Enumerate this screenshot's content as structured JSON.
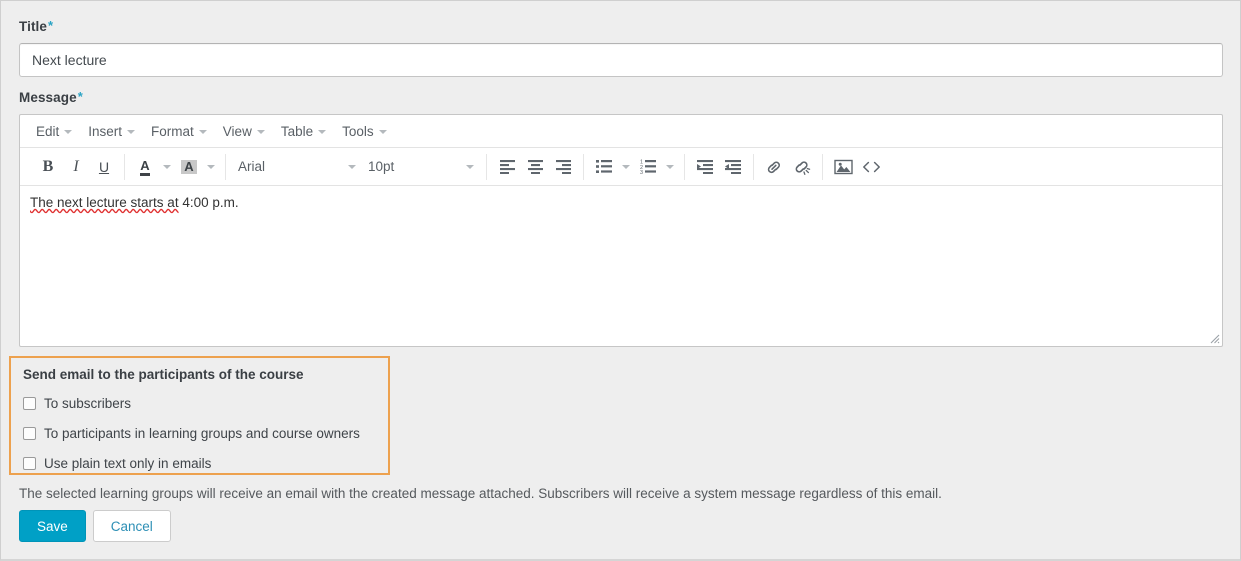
{
  "form": {
    "title_label": "Title",
    "required_marker": "*",
    "title_value": "Next lecture",
    "title_placeholder": "",
    "message_label": "Message"
  },
  "editor": {
    "menus": [
      {
        "label": "Edit",
        "icon": "chevron-down-icon"
      },
      {
        "label": "Insert",
        "icon": "chevron-down-icon"
      },
      {
        "label": "Format",
        "icon": "chevron-down-icon"
      },
      {
        "label": "View",
        "icon": "chevron-down-icon"
      },
      {
        "label": "Table",
        "icon": "chevron-down-icon"
      },
      {
        "label": "Tools",
        "icon": "chevron-down-icon"
      }
    ],
    "toolbar": {
      "bold": "B",
      "italic": "I",
      "underline": "U",
      "text_color_glyph": "A",
      "background_color_glyph": "A",
      "font_family": "Arial",
      "font_size": "10pt",
      "icons": [
        "align-left-icon",
        "align-center-icon",
        "align-right-icon",
        "bullet-list-icon",
        "numbered-list-icon",
        "indent-icon",
        "outdent-icon",
        "link-icon",
        "unlink-icon",
        "image-icon",
        "source-code-icon"
      ]
    },
    "content_misspelled": "The next lecture starts at",
    "content_rest": " 4:00 p.m."
  },
  "email_options": {
    "heading": "Send email to the participants of the course",
    "border_color": "#eda14e",
    "checkboxes": [
      {
        "label": "To subscribers",
        "checked": false
      },
      {
        "label": "To participants in learning groups and course owners",
        "checked": false
      },
      {
        "label": "Use plain text only in emails",
        "checked": false
      }
    ]
  },
  "footer": {
    "help_text": "The selected learning groups will receive an email with the created message attached. Subscribers will receive a system message regardless of this email.",
    "save_label": "Save",
    "cancel_label": "Cancel",
    "save_color": "#00a0c6",
    "cancel_text_color": "#2d8fb5"
  }
}
